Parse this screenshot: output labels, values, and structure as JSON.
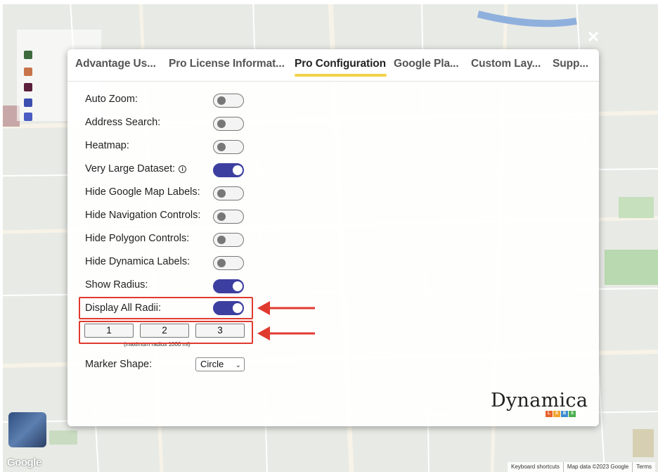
{
  "tabs": [
    {
      "label": "Advantage Us..."
    },
    {
      "label": "Pro License Informat..."
    },
    {
      "label": "Pro Configuration"
    },
    {
      "label": "Google Pla..."
    },
    {
      "label": "Custom Lay..."
    },
    {
      "label": "Supp..."
    }
  ],
  "active_tab": "Pro Configuration",
  "settings": [
    {
      "label": "Auto Zoom:",
      "on": false
    },
    {
      "label": "Address Search:",
      "on": false
    },
    {
      "label": "Heatmap:",
      "on": false
    },
    {
      "label": "Very Large Dataset:",
      "on": true,
      "info_icon": "ⓘ"
    },
    {
      "label": "Hide Google Map Labels:",
      "on": false
    },
    {
      "label": "Hide Navigation Controls:",
      "on": false
    },
    {
      "label": "Hide Polygon Controls:",
      "on": false
    },
    {
      "label": "Hide Dynamica Labels:",
      "on": false
    },
    {
      "label": "Show Radius:",
      "on": true
    },
    {
      "label": "Display All Radii:",
      "on": true
    }
  ],
  "radius_buttons": [
    "1",
    "2",
    "3"
  ],
  "radius_note": "(maximum radius 1000 mi)",
  "marker_shape": {
    "label": "Marker Shape:",
    "value": "Circle"
  },
  "brand": {
    "name": "Dynamica",
    "labs_letters": [
      "L",
      "A",
      "B",
      "S"
    ]
  },
  "map": {
    "logo": "Google",
    "attribution": [
      "Keyboard shortcuts",
      "Map data ©2023 Google",
      "Terms"
    ]
  },
  "colors": {
    "toggle_on": "#3d3fa0",
    "active_tab_underline": "#f3d24a",
    "highlight": "#e03a2f"
  },
  "icons": {
    "close": "close-icon",
    "info": "info-icon",
    "chevron": "chevron-down-icon"
  }
}
